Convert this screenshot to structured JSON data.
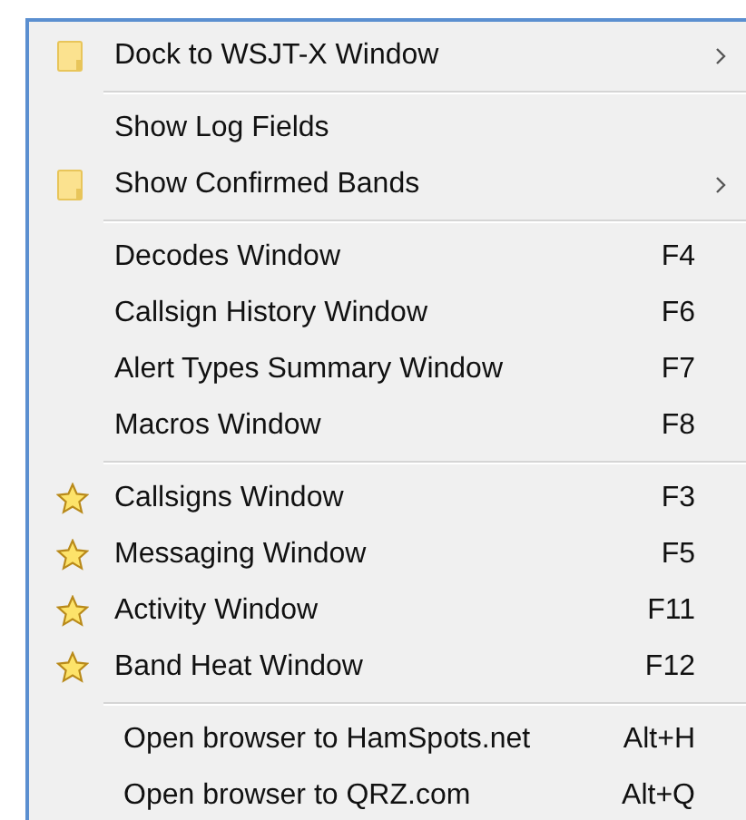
{
  "menu": {
    "sections": [
      {
        "items": [
          {
            "label": "Dock to WSJT-X Window",
            "kind": "folder",
            "submenu": true
          }
        ]
      },
      {
        "items": [
          {
            "label": "Show Log Fields",
            "kind": "plain",
            "submenu": false
          },
          {
            "label": "Show Confirmed Bands",
            "kind": "folder",
            "submenu": true
          }
        ]
      },
      {
        "items": [
          {
            "label": "Decodes Window",
            "shortcut": "F4",
            "kind": "plain"
          },
          {
            "label": "Callsign History Window",
            "shortcut": "F6",
            "kind": "plain"
          },
          {
            "label": "Alert Types Summary Window",
            "shortcut": "F7",
            "kind": "plain"
          },
          {
            "label": "Macros Window",
            "shortcut": "F8",
            "kind": "plain"
          }
        ]
      },
      {
        "items": [
          {
            "label": "Callsigns Window",
            "shortcut": "F3",
            "kind": "star"
          },
          {
            "label": "Messaging Window",
            "shortcut": "F5",
            "kind": "star"
          },
          {
            "label": "Activity Window",
            "shortcut": "F11",
            "kind": "star"
          },
          {
            "label": "Band Heat Window",
            "shortcut": "F12",
            "kind": "star"
          }
        ]
      },
      {
        "items": [
          {
            "label": "Open browser to HamSpots.net",
            "shortcut": "Alt+H",
            "kind": "link"
          },
          {
            "label": "Open browser to QRZ.com",
            "shortcut": "Alt+Q",
            "kind": "link"
          }
        ]
      }
    ]
  }
}
